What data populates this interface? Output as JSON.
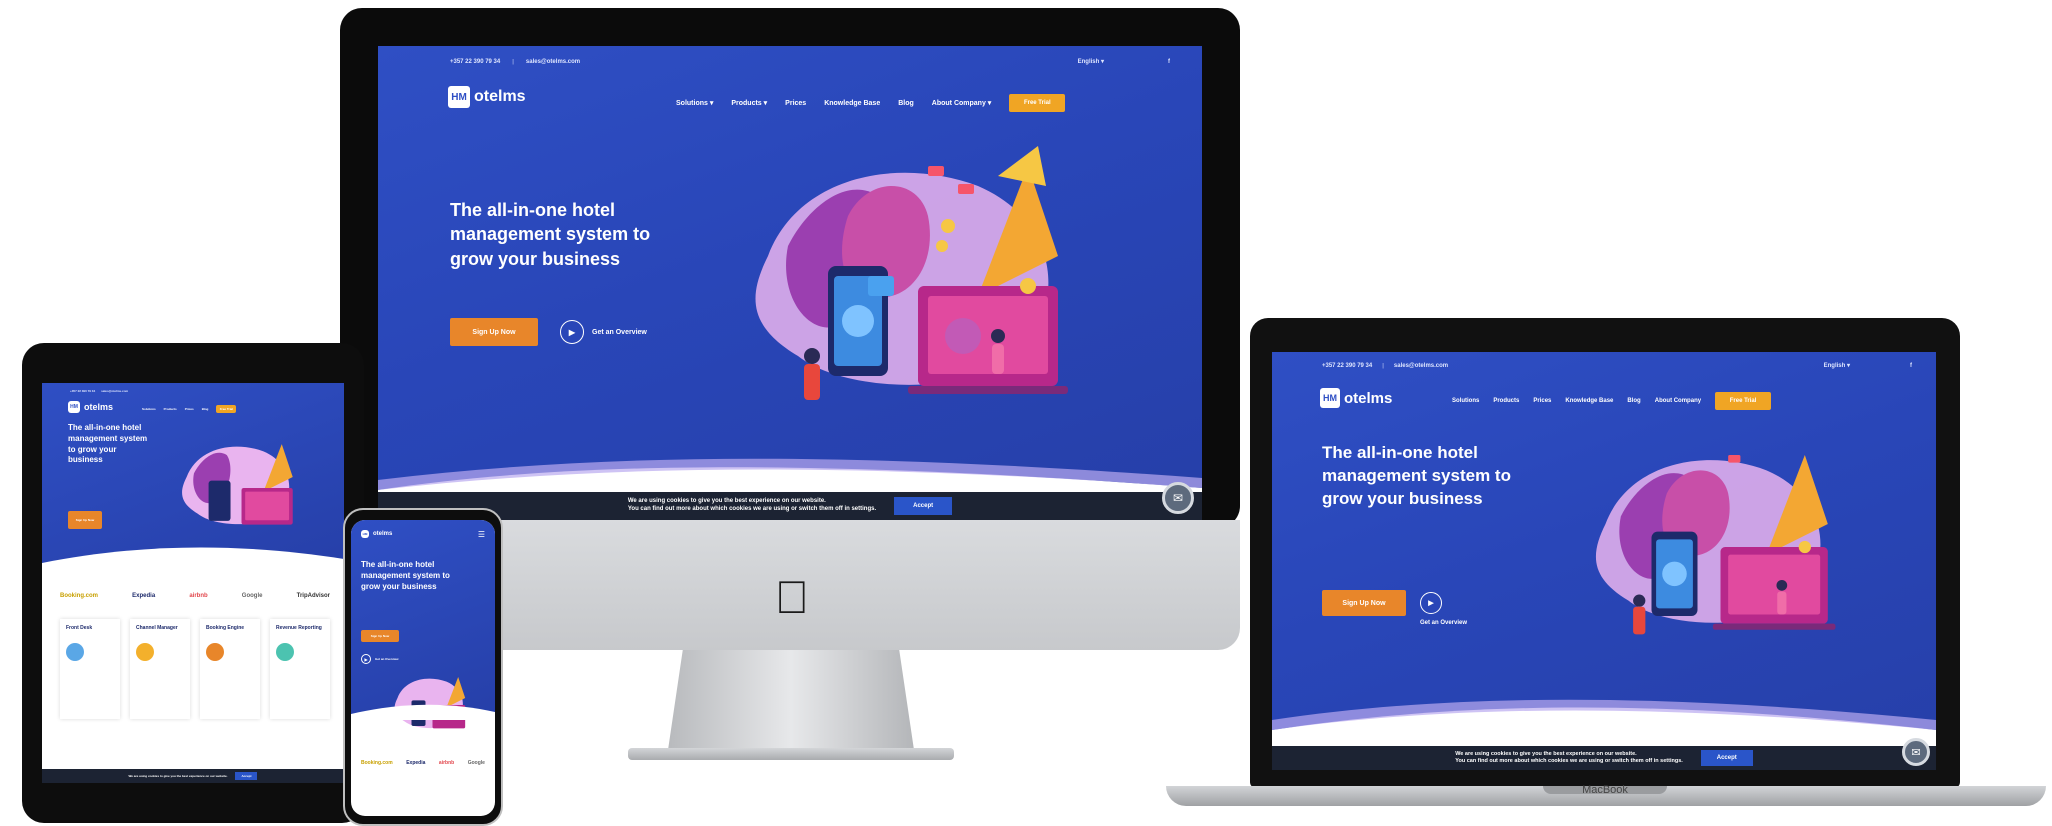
{
  "site": {
    "phone": "+357 22 390 79 34",
    "email": "sales@otelms.com",
    "language": "English",
    "brand": "otelms",
    "nav": {
      "solutions": "Solutions",
      "products": "Products",
      "prices": "Prices",
      "knowledge_base": "Knowledge Base",
      "blog": "Blog",
      "about": "About Company",
      "cta": "Free Trial"
    },
    "hero_title": "The all-in-one hotel management system to grow your business",
    "sign_up": "Sign Up Now",
    "overview": "Get an Overview",
    "cookie_text_1": "We are using cookies to give you the best experience on our website.",
    "cookie_text_2": "You can find out more about which cookies we are using or switch them off in settings.",
    "accept": "Accept",
    "partners": [
      "Booking.com",
      "Expedia",
      "airbnb",
      "Google",
      "TripAdvisor"
    ],
    "cards": [
      "Front Desk",
      "Channel Manager",
      "Booking Engine",
      "Revenue Reporting"
    ]
  },
  "devices": {
    "laptop_label": "MacBook"
  },
  "colors": {
    "brand_blue": "#2f4fc4",
    "accent_orange": "#e8862a",
    "cta_yellow": "#f0a524",
    "cookie_bg": "#1c2333"
  }
}
